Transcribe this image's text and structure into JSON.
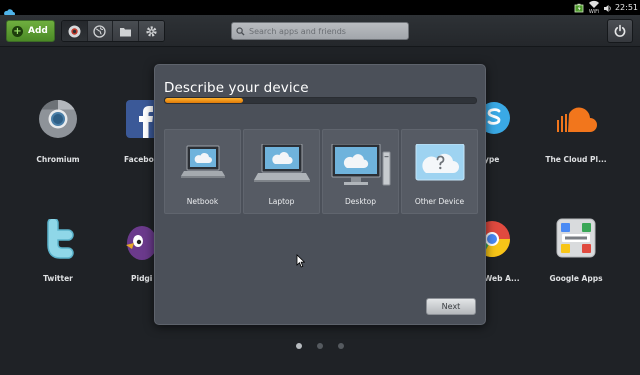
{
  "system_bar": {
    "wifi_label": "WiFi",
    "clock": "22:51"
  },
  "toolbar": {
    "add_label": "Add",
    "tabs": [
      "apps-tab-icon",
      "globe-tab-icon",
      "folder-tab-icon",
      "settings-tab-icon"
    ],
    "search_placeholder": "Search apps and friends"
  },
  "launcher": {
    "apps": [
      {
        "label": "Chromium"
      },
      {
        "label": "Facebo"
      },
      {
        "label": "ype"
      },
      {
        "label": "The Cloud Pl..."
      },
      {
        "label": "Twitter"
      },
      {
        "label": "Pidgi"
      },
      {
        "label": "Web A..."
      },
      {
        "label": "Google Apps"
      }
    ],
    "pager_pages": 3,
    "pager_active": 1
  },
  "dialog": {
    "title": "Describe your device",
    "progress_fraction": 0.25,
    "options": [
      {
        "label": "Netbook"
      },
      {
        "label": "Laptop"
      },
      {
        "label": "Desktop"
      },
      {
        "label": "Other Device"
      }
    ],
    "next_label": "Next"
  },
  "colors": {
    "accent_orange": "#f39a1b",
    "add_green": "#5d9c31",
    "dialog_bg": "#4b5059",
    "background": "#1f2226"
  }
}
